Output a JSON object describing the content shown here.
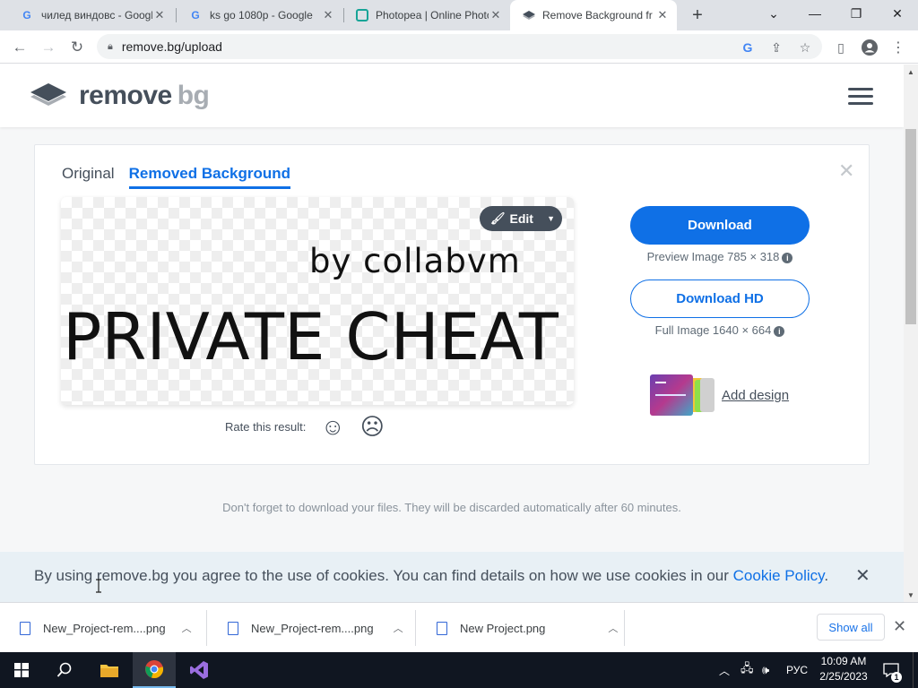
{
  "browser": {
    "tabs": [
      {
        "title": "чилед виндовс - Google",
        "favicon": "google-g"
      },
      {
        "title": "ks go 1080p - Google",
        "favicon": "google-g"
      },
      {
        "title": "Photopea | Online Photo",
        "favicon": "photopea"
      },
      {
        "title": "Remove Background fr",
        "favicon": "removebg",
        "active": true
      }
    ],
    "url": "remove.bg/upload"
  },
  "site": {
    "logo_word1": "remove",
    "logo_word2": "bg"
  },
  "result": {
    "tab_original": "Original",
    "tab_removed": "Removed Background",
    "preview_line1": "by collabvm",
    "preview_line2": "PRIVATE CHEAT",
    "edit_label": "Edit",
    "rate_label": "Rate this result:",
    "download_label": "Download",
    "preview_info": "Preview Image 785 × 318",
    "download_hd_label": "Download HD",
    "full_info": "Full Image 1640 × 664",
    "add_design_label": "Add design"
  },
  "notice": "Don't forget to download your files. They will be discarded automatically after 60 minutes.",
  "cookie": {
    "text": "By using remove.bg you agree to the use of cookies. You can find details on how we use cookies in our ",
    "link": "Cookie Policy",
    "suffix": "."
  },
  "downloads": {
    "items": [
      "New_Project-rem....png",
      "New_Project-rem....png",
      "New Project.png"
    ],
    "show_all": "Show all"
  },
  "taskbar": {
    "language": "РУС",
    "time": "10:09 AM",
    "date": "2/25/2023",
    "notification_count": "1"
  },
  "colors": {
    "accent": "#0f70e6",
    "logo_dark": "#454f5b",
    "logo_light": "#a8adb3"
  }
}
